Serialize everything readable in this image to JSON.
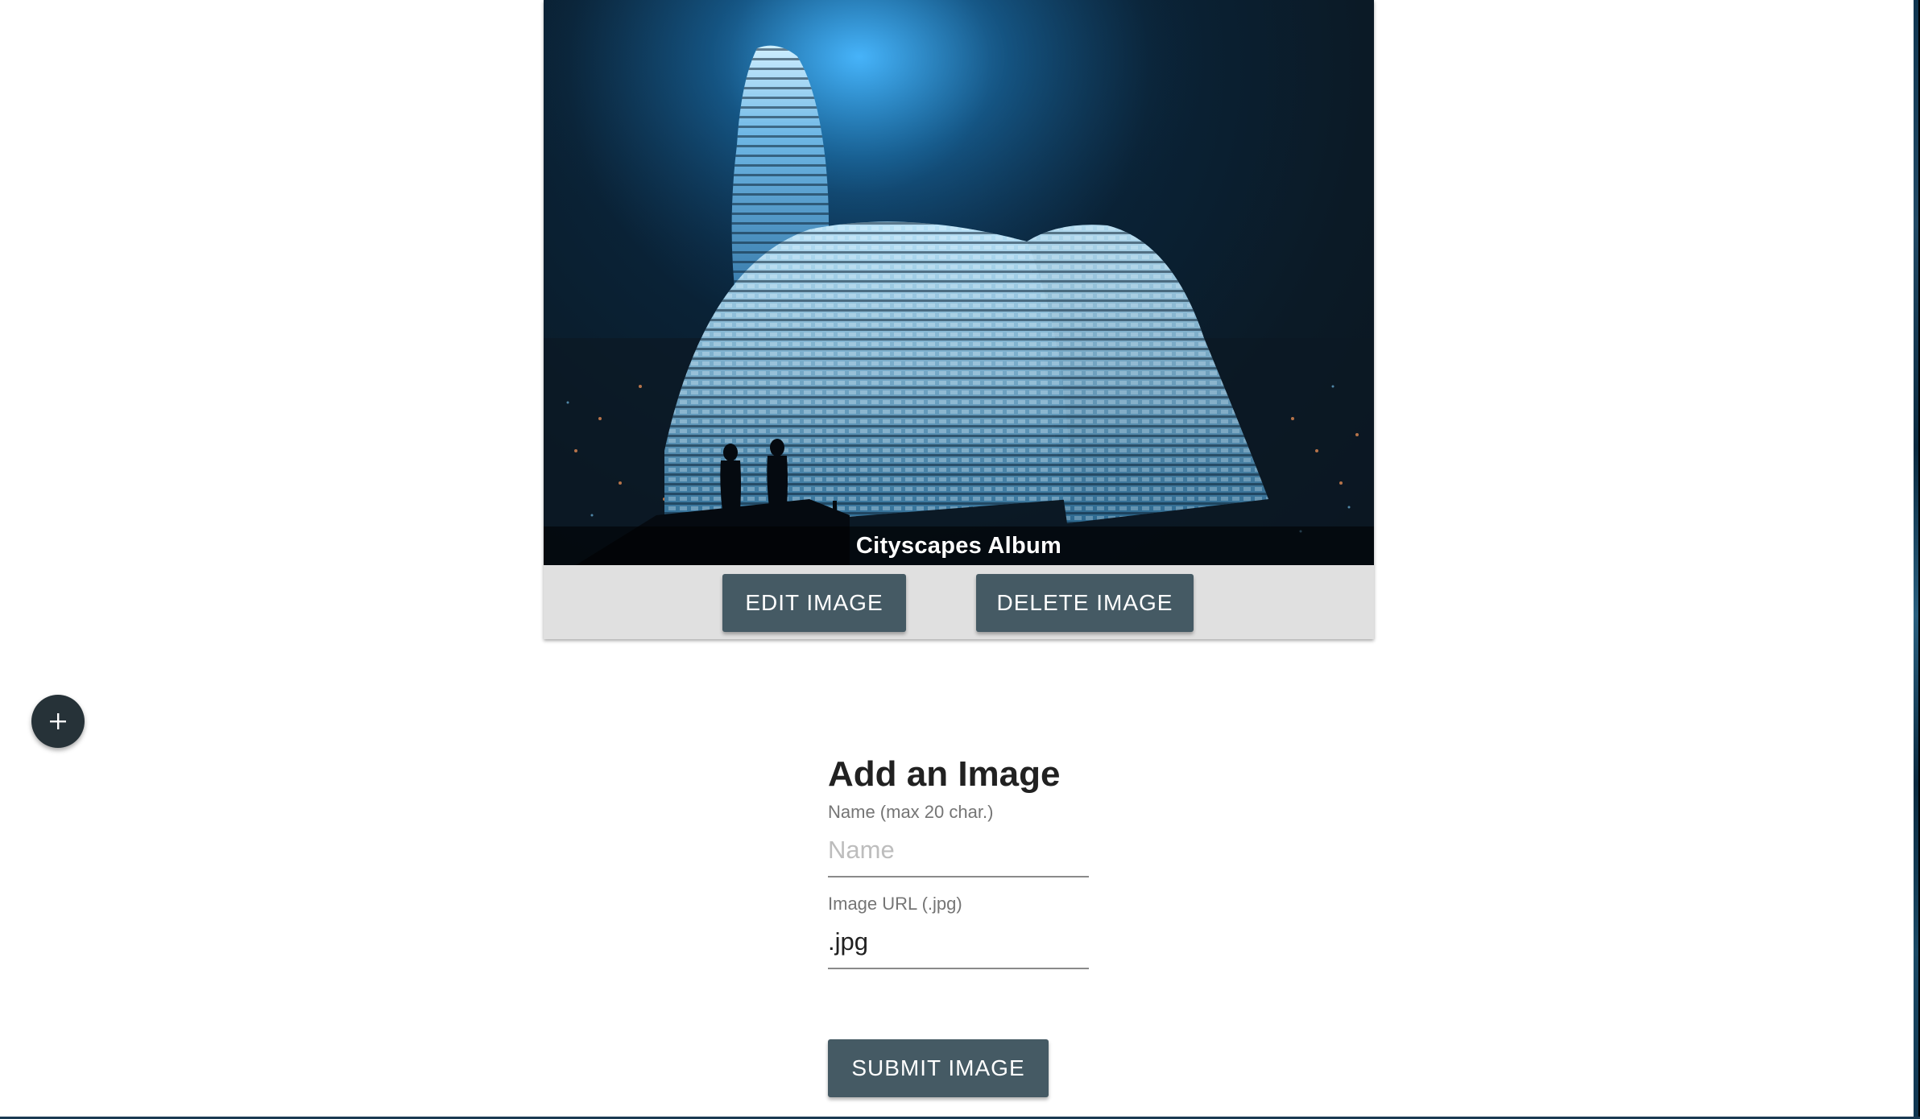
{
  "card": {
    "caption": "Cityscapes Album",
    "image_description_icon": "photo",
    "edit_label": "EDIT IMAGE",
    "delete_label": "DELETE IMAGE"
  },
  "fab": {
    "icon": "plus-icon"
  },
  "form": {
    "title": "Add an Image",
    "name_label": "Name (max 20 char.)",
    "name_placeholder": "Name",
    "name_value": "",
    "url_label": "Image URL (.jpg)",
    "url_value": ".jpg",
    "submit_label": "SUBMIT IMAGE"
  },
  "colors": {
    "button": "#455a64",
    "fab": "#263238",
    "card_actions_bg": "#e0e0e0"
  }
}
